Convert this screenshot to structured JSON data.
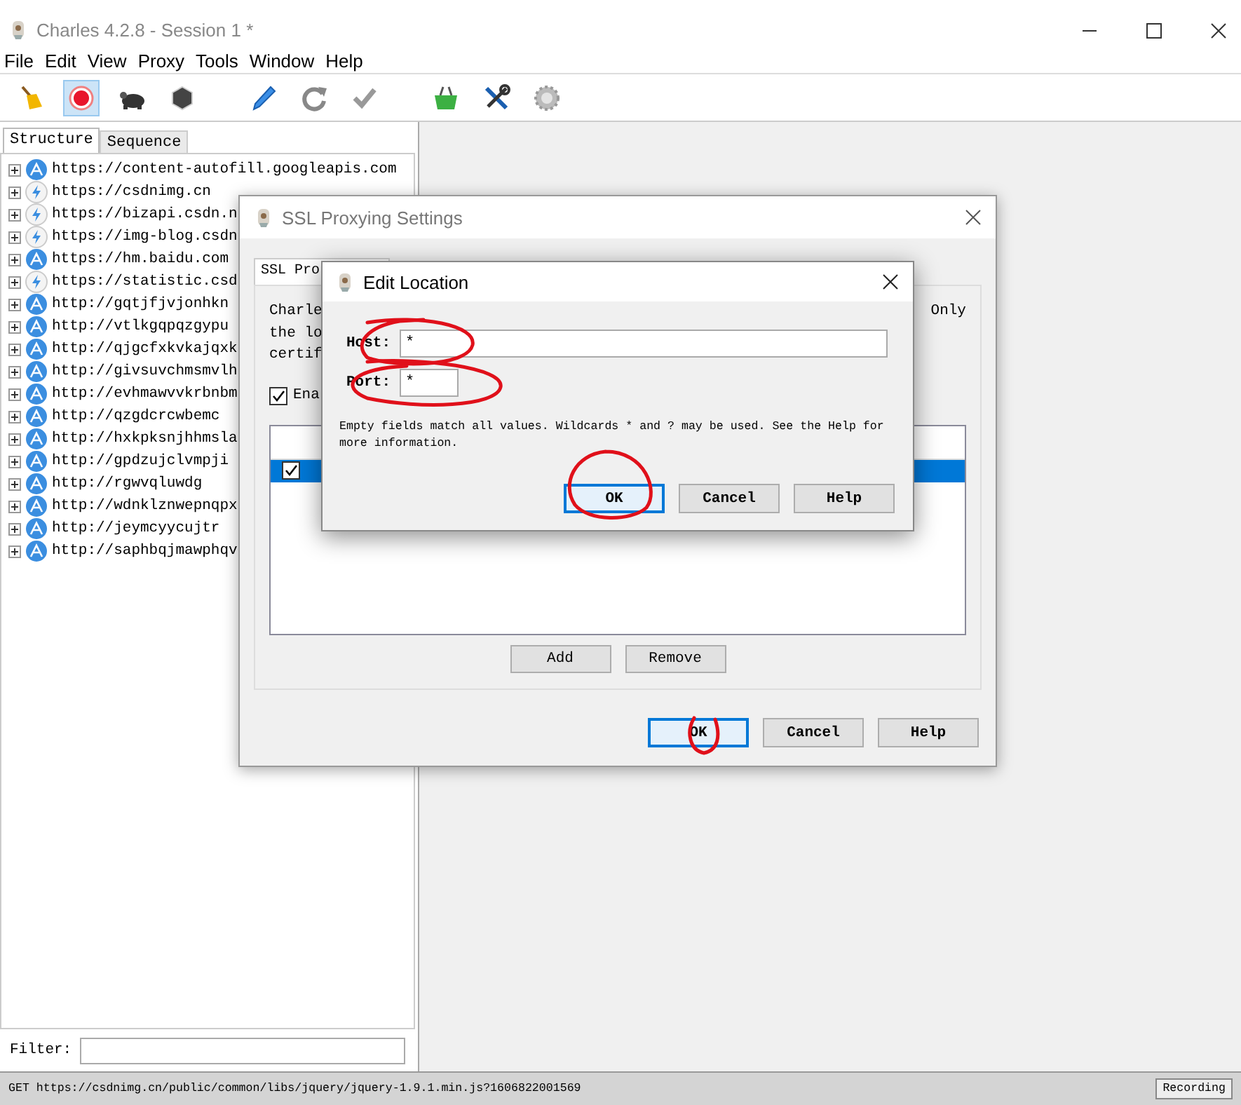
{
  "window": {
    "title": "Charles 4.2.8 - Session 1 *"
  },
  "menu": [
    "File",
    "Edit",
    "View",
    "Proxy",
    "Tools",
    "Window",
    "Help"
  ],
  "toolbar": [
    {
      "selected": false
    },
    {
      "selected": true
    },
    {
      "selected": false
    },
    {
      "selected": false
    },
    {
      "selected": false
    },
    {
      "selected": false
    },
    {
      "selected": false
    },
    {
      "selected": false
    },
    {
      "selected": false
    },
    {
      "selected": false
    }
  ],
  "left_tabs": [
    {
      "label": "Structure",
      "selected": true
    },
    {
      "label": "Sequence",
      "selected": false
    }
  ],
  "tree": [
    {
      "kind": "globe",
      "label": "https://content-autofill.googleapis.com",
      "expanded": false
    },
    {
      "kind": "bolt",
      "label": "https://csdnimg.cn",
      "expanded": false
    },
    {
      "kind": "bolt",
      "label": "https://bizapi.csdn.n",
      "expanded": false
    },
    {
      "kind": "bolt",
      "label": "https://img-blog.csdn",
      "expanded": false
    },
    {
      "kind": "globe",
      "label": "https://hm.baidu.com",
      "expanded": false
    },
    {
      "kind": "bolt",
      "label": "https://statistic.csd",
      "expanded": false
    },
    {
      "kind": "globe",
      "label": "http://gqtjfjvjonhkn",
      "expanded": false
    },
    {
      "kind": "globe",
      "label": "http://vtlkgqpqzgypu",
      "expanded": false
    },
    {
      "kind": "globe",
      "label": "http://qjgcfxkvkajqxk",
      "expanded": false
    },
    {
      "kind": "globe",
      "label": "http://givsuvchmsmvlh",
      "expanded": false
    },
    {
      "kind": "globe",
      "label": "http://evhmawvvkrbnbm",
      "expanded": false
    },
    {
      "kind": "globe",
      "label": "http://qzgdcrcwbemc",
      "expanded": false
    },
    {
      "kind": "globe",
      "label": "http://hxkpksnjhhmsla",
      "expanded": false
    },
    {
      "kind": "globe",
      "label": "http://gpdzujclvmpji",
      "expanded": false
    },
    {
      "kind": "globe",
      "label": "http://rgwvqluwdg",
      "expanded": false
    },
    {
      "kind": "globe",
      "label": "http://wdnklznwepnqpx",
      "expanded": false
    },
    {
      "kind": "globe",
      "label": "http://jeymcyycujtr",
      "expanded": false
    },
    {
      "kind": "globe",
      "label": "http://saphbqjmawphqv",
      "expanded": false
    }
  ],
  "filter": {
    "label": "Filter:"
  },
  "status_bar": {
    "text": "GET https://csdnimg.cn/public/common/libs/jquery/jquery-1.9.1.min.js?1606822001569",
    "button": "Recording"
  },
  "ssl_dialog": {
    "title": "SSL Proxying Settings",
    "tabs": [
      {
        "label": "SSL Pro",
        "selected": true
      }
    ],
    "description_left": [
      "Charle",
      "the lo",
      "certif"
    ],
    "description_right": "Only",
    "enable": {
      "label": "Ena",
      "checked": true
    },
    "rows": [
      {
        "checked": true,
        "selected": true
      }
    ],
    "list_buttons": [
      "Add",
      "Remove"
    ],
    "buttons": [
      {
        "label": "OK",
        "default": true
      },
      {
        "label": "Cancel",
        "default": false
      },
      {
        "label": "Help",
        "default": false
      }
    ]
  },
  "edit_dialog": {
    "title": "Edit Location",
    "fields": [
      {
        "label": "Host:",
        "value": "*"
      },
      {
        "label": "Port:",
        "value": "*"
      }
    ],
    "hint": "Empty fields match all values. Wildcards * and ? may be used. See the Help for more information.",
    "buttons": [
      {
        "label": "OK",
        "default": true
      },
      {
        "label": "Cancel",
        "default": false
      },
      {
        "label": "Help",
        "default": false
      }
    ]
  }
}
